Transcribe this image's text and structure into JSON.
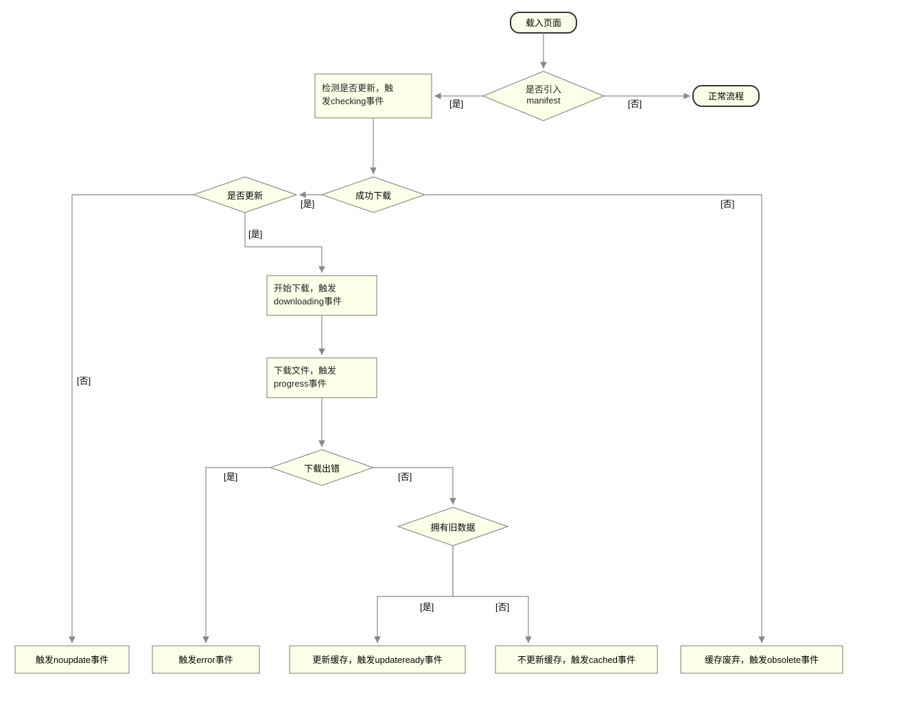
{
  "nodes": {
    "start": "载入页面",
    "manifest": "是否引入\nmanifest",
    "normal": "正常流程",
    "checking": "检测是否更新，触\n发checking事件",
    "success": "成功下载",
    "updated": "是否更新",
    "downloading": "开始下载，触发\ndownloading事件",
    "progress": "下载文件，触发\nprogress事件",
    "dlerror": "下载出错",
    "oldcache": "拥有旧数据",
    "noupdate": "触发noupdate事件",
    "error": "触发error事件",
    "updateready": "更新缓存，触发updateready事件",
    "cached": "不更新缓存，触发cached事件",
    "obsolete": "缓存废弃，触发obsolete事件"
  },
  "labels": {
    "yes": "[是]",
    "no": "[否]"
  }
}
